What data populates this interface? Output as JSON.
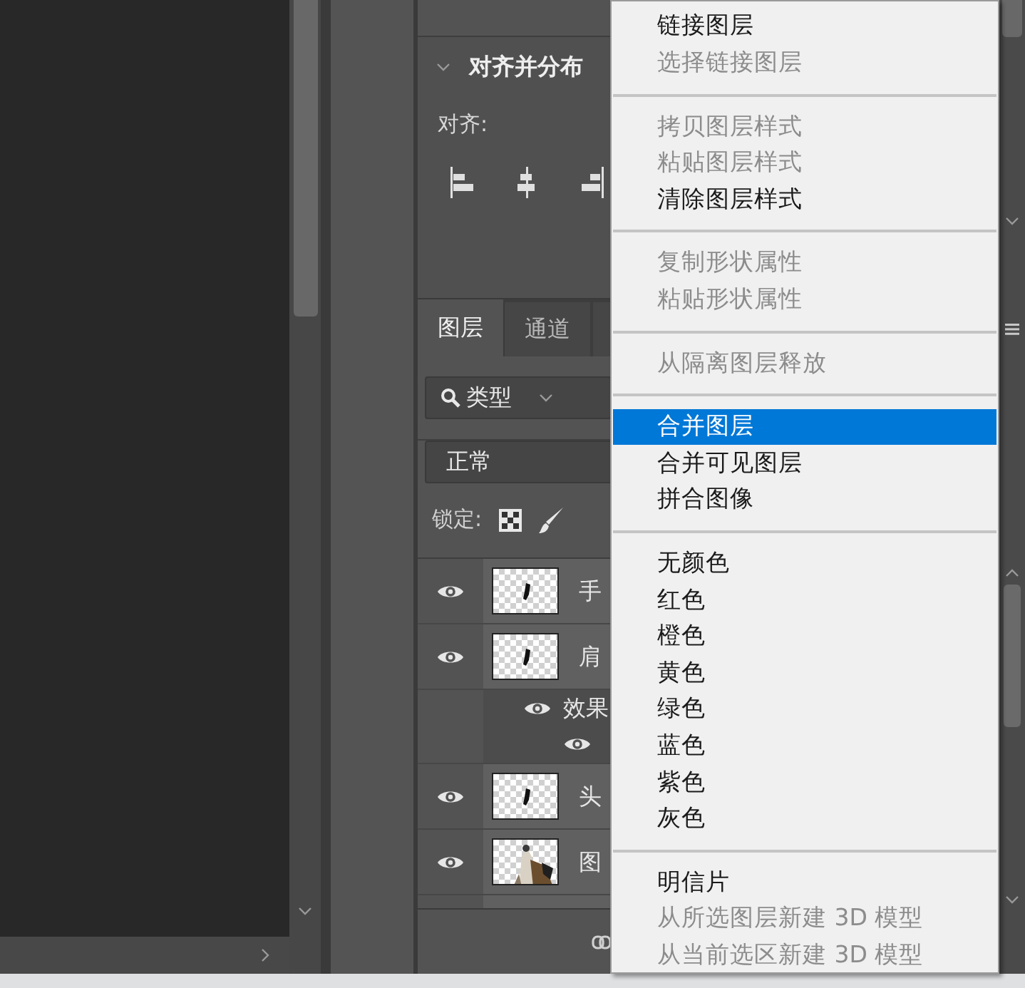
{
  "align_panel": {
    "title": "对齐并分布",
    "expanded": true,
    "align_label": "对齐:"
  },
  "layers_panel": {
    "tabs": [
      {
        "label": "图层",
        "selected": true
      },
      {
        "label": "通道",
        "selected": false
      }
    ],
    "filter": {
      "value": "类型"
    },
    "blend_mode": {
      "value": "正常"
    },
    "lock_label": "锁定:",
    "layers": [
      {
        "name": "手",
        "visible": true,
        "thumbnail": {
          "kind": "mark"
        }
      },
      {
        "name": "肩",
        "visible": true,
        "thumbnail": {
          "kind": "mark"
        },
        "effects": {
          "label": "效果",
          "visible": true,
          "items": [
            {
              "visible": true
            }
          ]
        }
      },
      {
        "name": "头",
        "visible": true,
        "thumbnail": {
          "kind": "mark"
        }
      },
      {
        "name": "图",
        "visible": true
      }
    ]
  },
  "context_menu": {
    "groups": [
      {
        "items": [
          {
            "label": "链接图层",
            "disabled": false,
            "selected": false
          },
          {
            "label": "选择链接图层",
            "disabled": true,
            "selected": false
          }
        ]
      },
      {
        "items": [
          {
            "label": "拷贝图层样式",
            "disabled": true,
            "selected": false
          },
          {
            "label": "粘贴图层样式",
            "disabled": true,
            "selected": false
          },
          {
            "label": "清除图层样式",
            "disabled": false,
            "selected": false
          }
        ]
      },
      {
        "items": [
          {
            "label": "复制形状属性",
            "disabled": true,
            "selected": false
          },
          {
            "label": "粘贴形状属性",
            "disabled": true,
            "selected": false
          }
        ]
      },
      {
        "items": [
          {
            "label": "从隔离图层释放",
            "disabled": true,
            "selected": false
          }
        ]
      },
      {
        "items": [
          {
            "label": "合并图层",
            "disabled": false,
            "selected": true
          },
          {
            "label": "合并可见图层",
            "disabled": false,
            "selected": false
          },
          {
            "label": "拼合图像",
            "disabled": false,
            "selected": false
          }
        ]
      },
      {
        "items": [
          {
            "label": "无颜色",
            "disabled": false,
            "selected": false
          },
          {
            "label": "红色",
            "disabled": false,
            "selected": false
          },
          {
            "label": "橙色",
            "disabled": false,
            "selected": false
          },
          {
            "label": "黄色",
            "disabled": false,
            "selected": false
          },
          {
            "label": "绿色",
            "disabled": false,
            "selected": false
          },
          {
            "label": "蓝色",
            "disabled": false,
            "selected": false
          },
          {
            "label": "紫色",
            "disabled": false,
            "selected": false
          },
          {
            "label": "灰色",
            "disabled": false,
            "selected": false
          }
        ]
      },
      {
        "items": [
          {
            "label": "明信片",
            "disabled": false,
            "selected": false
          },
          {
            "label": "从所选图层新建 3D 模型",
            "disabled": true,
            "selected": false
          },
          {
            "label": "从当前选区新建 3D 模型",
            "disabled": true,
            "selected": false
          }
        ]
      }
    ]
  }
}
